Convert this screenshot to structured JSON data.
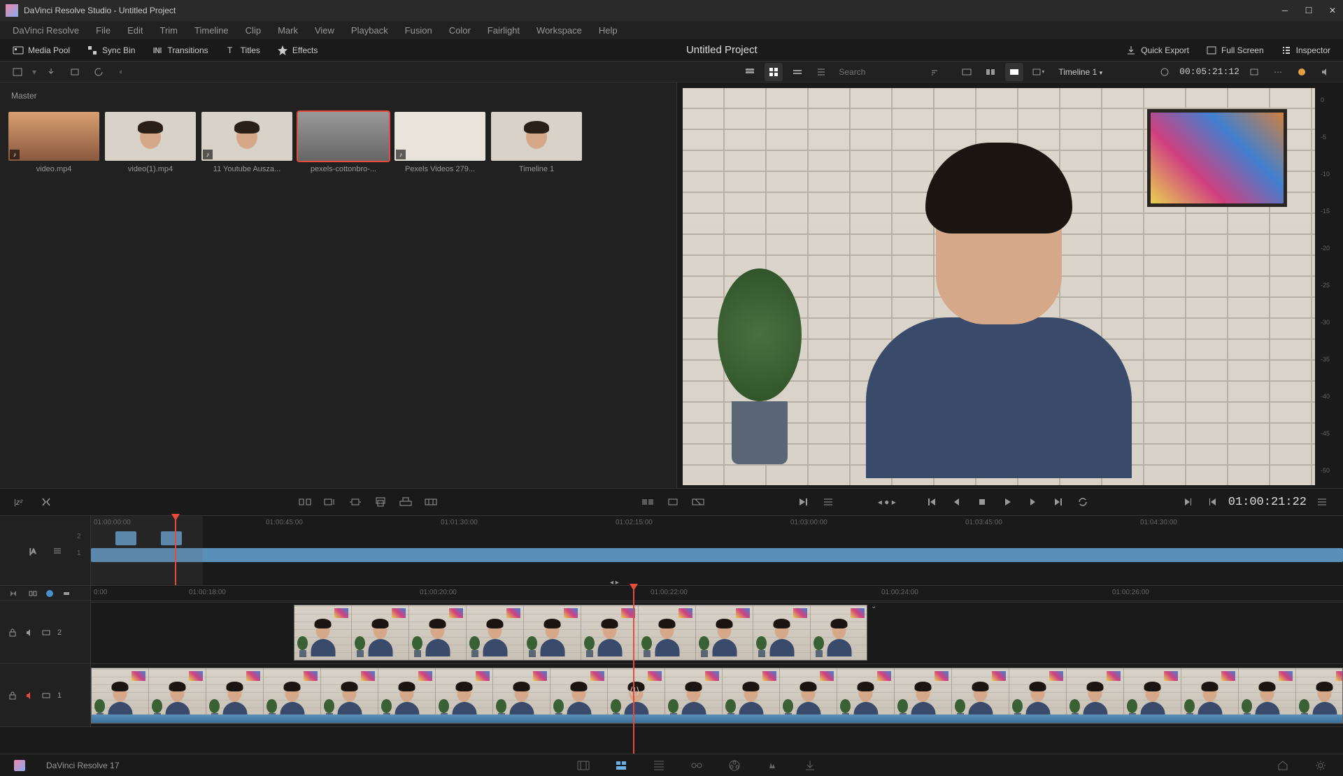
{
  "window": {
    "title": "DaVinci Resolve Studio - Untitled Project"
  },
  "menubar": [
    "DaVinci Resolve",
    "File",
    "Edit",
    "Trim",
    "Timeline",
    "Clip",
    "Mark",
    "View",
    "Playback",
    "Fusion",
    "Color",
    "Fairlight",
    "Workspace",
    "Help"
  ],
  "toolbar": {
    "media_pool": "Media Pool",
    "sync_bin": "Sync Bin",
    "transitions": "Transitions",
    "titles": "Titles",
    "effects": "Effects",
    "project_title": "Untitled Project",
    "quick_export": "Quick Export",
    "full_screen": "Full Screen",
    "inspector": "Inspector"
  },
  "subtoolbar": {
    "search_placeholder": "Search",
    "timeline_label": "Timeline 1",
    "source_timecode": "00:05:21:12"
  },
  "media": {
    "master_label": "Master",
    "items": [
      {
        "name": "video.mp4",
        "type": "video",
        "has_audio": true,
        "thumb": "sunset"
      },
      {
        "name": "video(1).mp4",
        "type": "video",
        "has_audio": false,
        "thumb": "face"
      },
      {
        "name": "11 Youtube Ausza...",
        "type": "video",
        "has_audio": true,
        "thumb": "face"
      },
      {
        "name": "pexels-cottonbro-...",
        "type": "video",
        "has_audio": false,
        "thumb": "skate",
        "selected": true
      },
      {
        "name": "Pexels Videos 279...",
        "type": "video",
        "has_audio": true,
        "thumb": "shoes"
      },
      {
        "name": "Timeline 1",
        "type": "timeline",
        "has_audio": false,
        "thumb": "face"
      }
    ]
  },
  "viewer": {
    "db_scale": [
      "0",
      "-5",
      "-10",
      "-15",
      "-20",
      "-25",
      "-30",
      "-35",
      "-40",
      "-45",
      "-50"
    ]
  },
  "transport": {
    "record_timecode": "01:00:21:22"
  },
  "timeline": {
    "overview_ruler": [
      "01:00:00:00",
      "01:00:45:00",
      "01:01:30:00",
      "01:02:15:00",
      "01:03:00:00",
      "01:03:45:00",
      "01:04:30:00"
    ],
    "detail_ruler": [
      "0:00",
      "01:00:18:00",
      "01:00:20:00",
      "01:00:22:00",
      "01:00:24:00",
      "01:00:26:00"
    ],
    "track_2": "2",
    "track_1": "1",
    "video_2": "2",
    "video_1": "1"
  },
  "footer": {
    "version": "DaVinci Resolve 17"
  }
}
